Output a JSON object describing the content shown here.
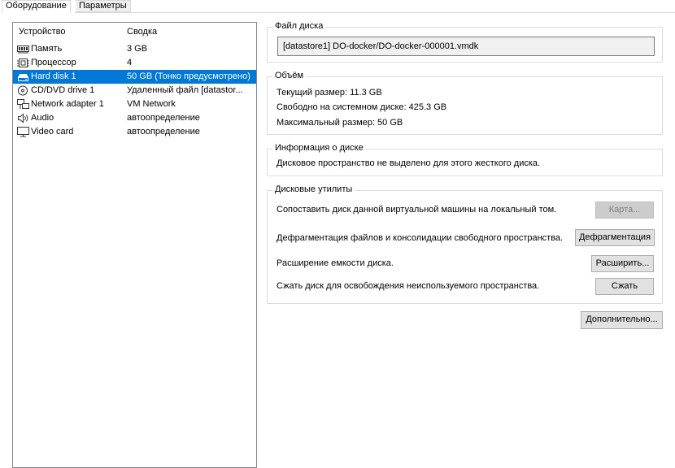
{
  "tabs": [
    {
      "label": "Оборудование",
      "active": true
    },
    {
      "label": "Параметры",
      "active": false
    }
  ],
  "device_list": {
    "headers": {
      "device": "Устройство",
      "summary": "Сводка"
    },
    "rows": [
      {
        "name": "Память",
        "summary": "3 GB",
        "icon": "memory-icon"
      },
      {
        "name": "Процессор",
        "summary": "4",
        "icon": "processor-icon"
      },
      {
        "name": "Hard disk 1",
        "summary": "50 GB (Тонко предусмотрено)",
        "icon": "hard-disk-icon",
        "selected": true
      },
      {
        "name": "CD/DVD drive 1",
        "summary": "Удаленный файл [datastor...",
        "icon": "cd-dvd-icon"
      },
      {
        "name": "Network adapter 1",
        "summary": "VM Network",
        "icon": "network-adapter-icon"
      },
      {
        "name": "Audio",
        "summary": "автоопределение",
        "icon": "audio-icon"
      },
      {
        "name": "Video card",
        "summary": "автоопределение",
        "icon": "video-card-icon"
      }
    ]
  },
  "disk_file": {
    "title": "Файл диска",
    "path": "[datastore1] DO-docker/DO-docker-000001.vmdk"
  },
  "capacity": {
    "title": "Объём",
    "current": "Текущий размер: 11.3 GB",
    "free": "Свободно на системном диске: 425.3 GB",
    "max": "Максимальный размер: 50 GB"
  },
  "disk_info": {
    "title": "Информация о диске",
    "text": "Дисковое пространство не выделено для этого жесткого диска."
  },
  "disk_utils": {
    "title": "Дисковые утилиты",
    "map_text": "Сопоставить диск данной виртуальной машины на локальный том.",
    "map_button": "Карта...",
    "defrag_text": "Дефрагментация файлов и консолидации свободного пространства.",
    "defrag_button": "Дефрагментация",
    "expand_text": "Расширение емкости диска.",
    "expand_button": "Расширить...",
    "compact_text": "Сжать диск для освобождения неиспользуемого пространства.",
    "compact_button": "Сжать"
  },
  "advanced_button": "Дополнительно...",
  "colors": {
    "selection": "#0078d7",
    "button_face": "#e1e1e1",
    "disabled_button": "#cccccc"
  }
}
